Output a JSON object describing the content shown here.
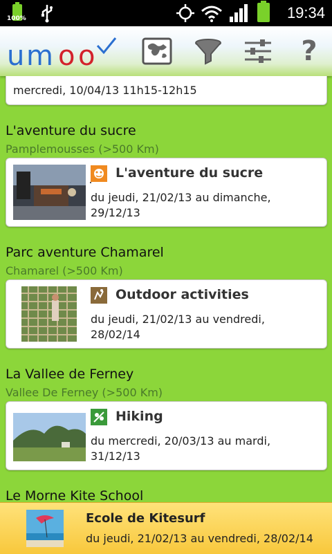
{
  "status_bar": {
    "time": "19:34",
    "battery_small_label": "100%",
    "icons": [
      "battery-icon",
      "usb-icon",
      "gps-icon",
      "wifi-icon",
      "signal-icon",
      "battery-icon"
    ]
  },
  "action_bar": {
    "logo_text": "umoo",
    "icons": [
      "map-icon",
      "filter-icon",
      "settings-sliders-icon",
      "help-icon"
    ],
    "help_glyph": "?"
  },
  "list": {
    "top_partial": {
      "date": "mercredi, 10/04/13 11h15-12h15"
    },
    "items": [
      {
        "title": "L'aventure du sucre",
        "location": "Pamplemousses (>500 Km)",
        "card_title": "L'aventure du sucre",
        "date": "du jeudi, 21/02/13 au dimanche, 29/12/13",
        "category_icon": "museum-icon"
      },
      {
        "title": "Parc aventure Chamarel",
        "location": "Chamarel (>500 Km)",
        "card_title": "Outdoor activities",
        "date": "du jeudi, 21/02/13 au vendredi, 28/02/14",
        "category_icon": "outdoor-icon"
      },
      {
        "title": "La Vallee de Ferney",
        "location": "Vallee De Ferney (>500 Km)",
        "card_title": "Hiking",
        "date": "du mercredi, 20/03/13 au mardi, 31/12/13",
        "category_icon": "hiking-icon"
      },
      {
        "title": "Le Morne Kite School"
      }
    ]
  },
  "ad": {
    "title": "Ecole de Kitesurf",
    "date": "du jeudi, 21/02/13 au vendredi, 28/02/14"
  },
  "colors": {
    "background": "#8cd63a",
    "location_text": "#4a7a2a",
    "ad_background": "#f8c83c"
  }
}
